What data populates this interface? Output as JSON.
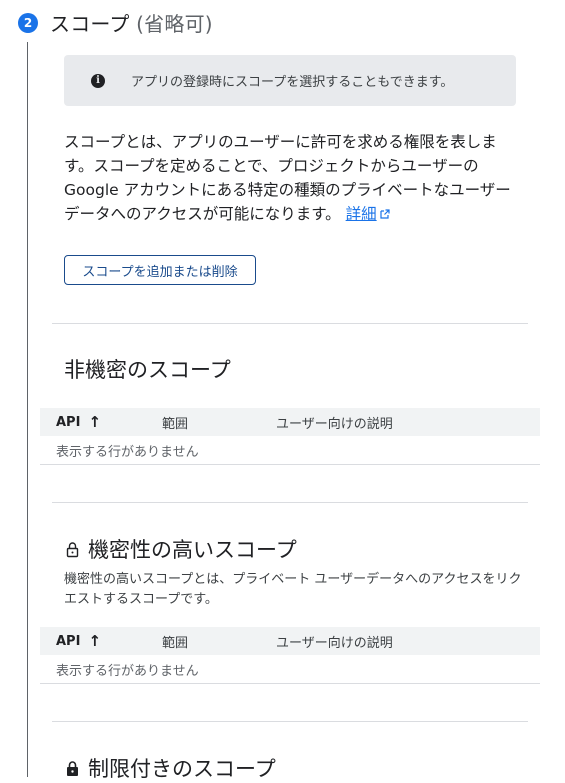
{
  "step": {
    "number": "2",
    "title": "スコープ",
    "optional_suffix": " (省略可)"
  },
  "info": {
    "icon": "info-icon",
    "text": "アプリの登録時にスコープを選択することもできます。"
  },
  "description": {
    "text": "スコープとは、アプリのユーザーに許可を求める権限を表します。スコープを定めることで、プロジェクトからユーザーの Google アカウントにある特定の種類のプライベートなユーザーデータへのアクセスが可能になります。",
    "link_label": "詳細",
    "link_icon": "external-link-icon"
  },
  "actions": {
    "add_remove_label": "スコープを追加または削除"
  },
  "table_columns": {
    "api": "API",
    "sort_arrow": "↑",
    "range": "範囲",
    "user_desc": "ユーザー向けの説明"
  },
  "sections": {
    "non_sensitive": {
      "title": "非機密のスコープ",
      "empty": "表示する行がありません"
    },
    "sensitive": {
      "title": "機密性の高いスコープ",
      "icon": "lock-open-icon",
      "description": "機密性の高いスコープとは、プライベート ユーザーデータへのアクセスをリクエストするスコープです。",
      "empty": "表示する行がありません"
    },
    "restricted": {
      "title": "制限付きのスコープ",
      "icon": "lock-icon"
    }
  },
  "colors": {
    "accent": "#1a73e8",
    "button_border": "#1a4b8c",
    "info_bg": "#e8eaed",
    "table_header_bg": "#f1f3f4"
  }
}
